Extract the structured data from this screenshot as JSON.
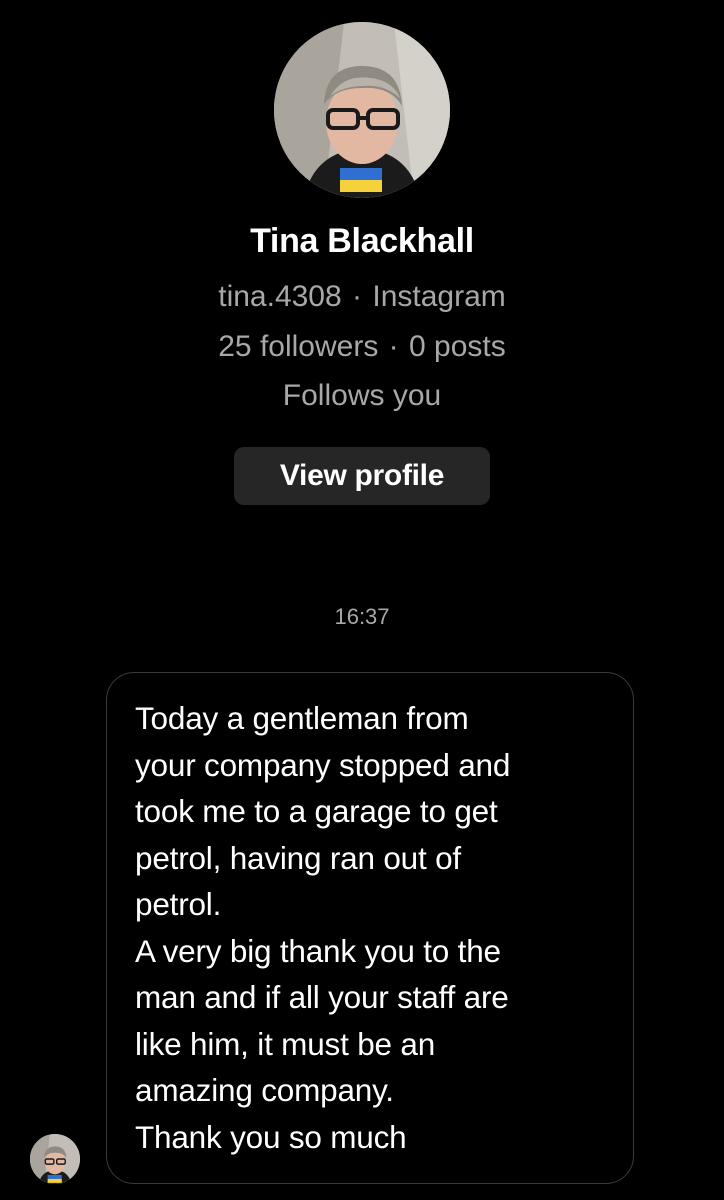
{
  "profile": {
    "name": "Tina Blackhall",
    "username": "tina.4308",
    "platform": "Instagram",
    "followers": "25 followers",
    "posts": "0 posts",
    "follow_status": "Follows you",
    "view_profile_label": "View profile",
    "separator": "·"
  },
  "thread": {
    "timestamp": "16:37",
    "messages": [
      {
        "text": "Today a gentleman from\nyour company stopped and\ntook me to a garage to get\npetrol, having ran out of\npetrol.\nA very big thank you to the\nman and if all your staff are\nlike him, it must be an\namazing company.\nThank you so much"
      }
    ]
  },
  "colors": {
    "background": "#000000",
    "primary_text": "#ffffff",
    "secondary_text": "#a8a8a8",
    "button_bg": "#262626",
    "bubble_border": "#3a3a3a",
    "flag_blue": "#2f6fd1",
    "flag_yellow": "#f5d23a"
  },
  "icons": {
    "profile_avatar": "profile-photo-avatar",
    "sender_avatar": "sender-avatar"
  }
}
